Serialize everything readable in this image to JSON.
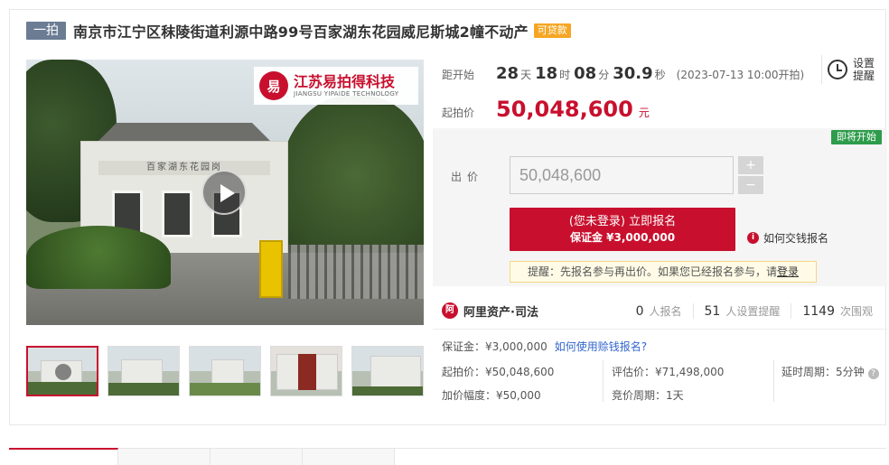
{
  "header": {
    "auction_tag": "一拍",
    "title": "南京市江宁区秣陵街道利源中路99号百家湖东花园威尼斯城2幢不动产",
    "loan_tag": "可贷款"
  },
  "gallery": {
    "watermark_logo": "易",
    "watermark_cn": "江苏易拍得科技",
    "watermark_en": "JIANGSU YIPAIDE TECHNOLOGY",
    "building_sign": "百家湖东花园岗",
    "thumb_count": 5,
    "active_thumb": 0
  },
  "countdown": {
    "label": "距开始",
    "days": "28",
    "days_unit": "天",
    "hours": "18",
    "hours_unit": "时",
    "minutes": "08",
    "minutes_unit": "分",
    "seconds": "30.9",
    "seconds_unit": "秒",
    "start_time": "(2023-07-13 10:00开拍)"
  },
  "start_price": {
    "label": "起拍价",
    "value": "50,048,600",
    "unit": "元"
  },
  "reminder": {
    "label": "设置提醒"
  },
  "bid": {
    "status_badge": "即将开始",
    "label": "出价",
    "input_value": "50,048,600",
    "plus": "+",
    "minus": "−",
    "signup_main": "(您未登录) 立即报名",
    "signup_sub": "保证金 ¥3,000,000",
    "help_link": "如何交钱报名",
    "tip_text": "提醒：先报名参与再出价。如果您已经报名参与，请",
    "tip_link": "登录"
  },
  "platform": {
    "logo_glyph": "阿",
    "name": "阿里资产·司法"
  },
  "stats": [
    {
      "num": "0",
      "unit": "人报名"
    },
    {
      "num": "51",
      "unit": "人设置提醒"
    },
    {
      "num": "1149",
      "unit": "次围观"
    }
  ],
  "details": {
    "deposit": "保证金：¥3,000,000",
    "deposit_link": "如何使用赊钱报名?",
    "start_price": "起拍价：¥50,048,600",
    "appraisal": "评估价：¥71,498,000",
    "delay": "延时周期：5分钟",
    "increment": "加价幅度：¥50,000",
    "bid_period": "竞价周期：1天"
  },
  "colors": {
    "accent": "#c8102e",
    "loan_tag": "#f5a623",
    "status_green": "#2e9c4b",
    "link_blue": "#3366cc"
  }
}
